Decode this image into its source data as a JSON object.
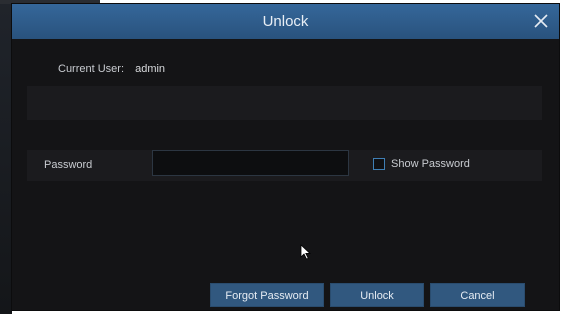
{
  "dialog": {
    "title": "Unlock",
    "close_icon": "close-icon"
  },
  "user": {
    "label": "Current User:",
    "value": "admin"
  },
  "password": {
    "label": "Password",
    "value": "",
    "show_label": "Show Password",
    "show_checked": false
  },
  "buttons": {
    "forgot": "Forgot Password",
    "unlock": "Unlock",
    "cancel": "Cancel"
  },
  "colors": {
    "titlebar": "#2f5d8c",
    "dialog_bg": "#141416",
    "button_bg": "#31587f",
    "checkbox_border": "#3f7fb5"
  }
}
